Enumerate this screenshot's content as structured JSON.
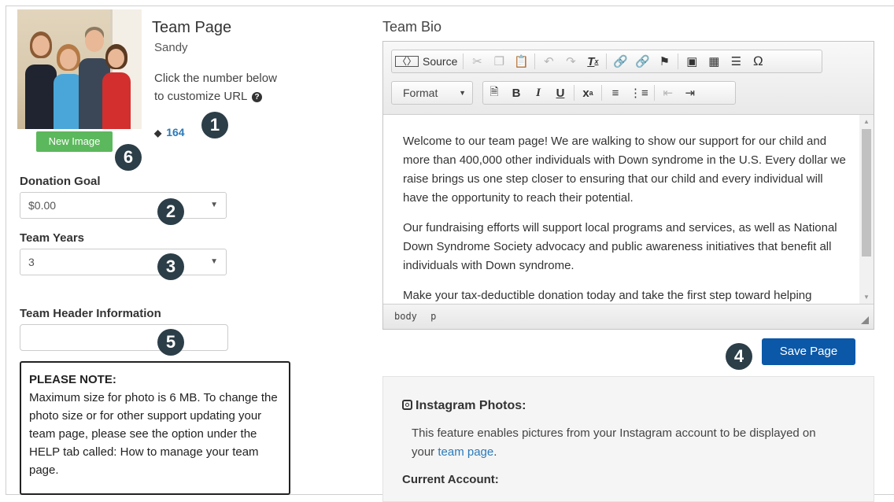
{
  "team": {
    "title": "Team Page",
    "name": "Sandy",
    "hint": "Click the number below to customize URL",
    "url_id": "164",
    "new_image_label": "New Image"
  },
  "badges": [
    "1",
    "2",
    "3",
    "4",
    "5",
    "6"
  ],
  "donation_goal": {
    "label": "Donation Goal",
    "value": "$0.00"
  },
  "team_years": {
    "label": "Team Years",
    "value": "3"
  },
  "team_header": {
    "label": "Team Header Information",
    "value": ""
  },
  "note": {
    "heading": "PLEASE NOTE:",
    "body": "Maximum size for photo is 6 MB. To change the photo size or for other support updating your team page, please see the option under the HELP tab called: How to manage your team page."
  },
  "bio": {
    "label": "Team Bio",
    "toolbar": {
      "source_label": "Source",
      "format_label": "Format"
    },
    "paragraphs": [
      "Welcome to our team page!  We are walking to show our support for our child and more than 400,000 other individuals with Down syndrome in the U.S. Every dollar we raise brings us one step closer to ensuring that our child and every individual will have the opportunity to reach their potential.",
      "Our fundraising efforts will support local programs and services, as well as National Down Syndrome Society advocacy and public awareness initiatives that benefit all individuals with Down syndrome.",
      "Make your tax-deductible donation today and take the first step toward helping"
    ],
    "path": [
      "body",
      "p"
    ]
  },
  "save_label": "Save Page",
  "instagram": {
    "title": "Instagram Photos:",
    "desc_before": "This feature enables pictures from your Instagram account to be displayed on your ",
    "link": "team page",
    "desc_after": ".",
    "account_label": "Current Account:"
  },
  "colors": {
    "save_button": "#0b58a8",
    "new_image_button": "#5cb85c",
    "badge": "#2c3e48",
    "link": "#2a7ab9"
  }
}
